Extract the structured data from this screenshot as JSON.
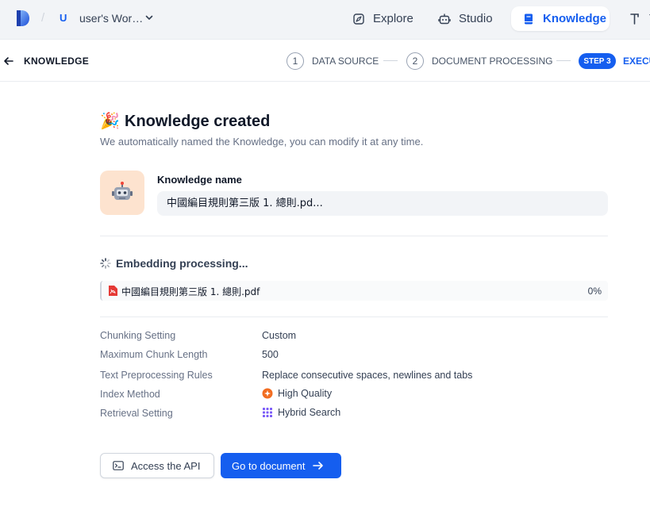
{
  "header": {
    "workspace_initial": "U",
    "workspace_name": "user's Wor…",
    "nav": {
      "explore": "Explore",
      "studio": "Studio",
      "knowledge": "Knowledge",
      "tools": "T"
    }
  },
  "stepbar": {
    "back_title": "KNOWLEDGE",
    "steps": [
      {
        "number": "1",
        "label": "DATA SOURCE"
      },
      {
        "number": "2",
        "label": "DOCUMENT PROCESSING"
      },
      {
        "number": "STEP 3",
        "label": "EXECU"
      }
    ]
  },
  "main": {
    "emoji": "🎉",
    "title": "Knowledge created",
    "subtitle": "We automatically named the Knowledge, you can modify it at any time.",
    "knowledge_name_label": "Knowledge name",
    "knowledge_name_value": "中國編目規則第三版 1. 總則.pd...",
    "embedding_status": "Embedding processing...",
    "file": {
      "name": "中國編目規則第三版 1. 總則.pdf",
      "progress": "0%"
    },
    "settings": [
      {
        "key": "Chunking Setting",
        "value": "Custom"
      },
      {
        "key": "Maximum Chunk Length",
        "value": "500"
      },
      {
        "key": "Text Preprocessing Rules",
        "value": "Replace consecutive spaces, newlines and tabs"
      },
      {
        "key": "Index Method",
        "value": "High Quality",
        "icon": "high-quality-icon"
      },
      {
        "key": "Retrieval Setting",
        "value": "Hybrid Search",
        "icon": "hybrid-search-icon"
      }
    ],
    "buttons": {
      "access_api": "Access the API",
      "go_to_document": "Go to document"
    }
  },
  "colors": {
    "accent": "#155eef",
    "nav_bg": "#f2f4f7",
    "kb_icon_bg": "#fde3cf",
    "high_quality": "#f26d21",
    "hybrid_search": "#7a5af8"
  }
}
